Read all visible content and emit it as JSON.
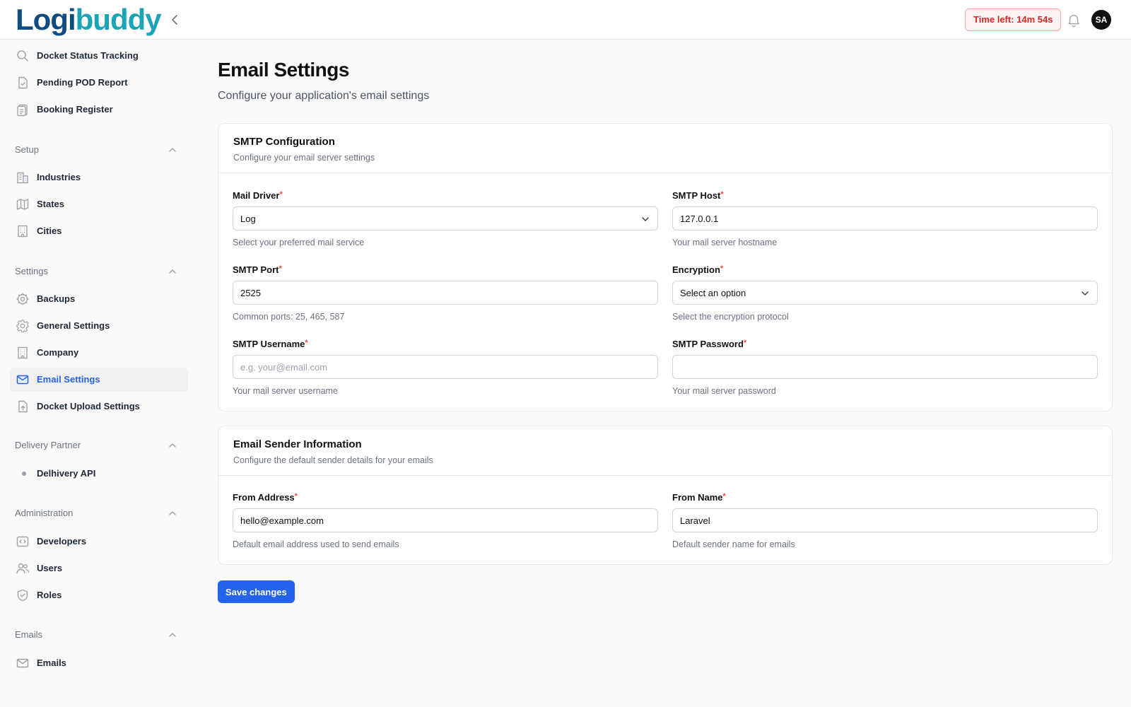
{
  "header": {
    "logo_text_a": "Logi",
    "logo_text_b": "bu",
    "logo_text_c": "ddy",
    "timer": "Time left: 14m 54s",
    "avatar_initials": "SA"
  },
  "sidebar": {
    "top_items": [
      {
        "label": "Docket Status Tracking",
        "icon": "search-icon"
      },
      {
        "label": "Pending POD Report",
        "icon": "file-check-icon"
      },
      {
        "label": "Booking Register",
        "icon": "clipboard-icon"
      }
    ],
    "sections": {
      "setup": {
        "label": "Setup",
        "items": [
          "Industries",
          "States",
          "Cities"
        ]
      },
      "settings": {
        "label": "Settings",
        "items": [
          "Backups",
          "General Settings",
          "Company",
          "Email Settings",
          "Docket Upload Settings"
        ]
      },
      "delivery_partner": {
        "label": "Delivery Partner",
        "items": [
          "Delhivery API"
        ]
      },
      "administration": {
        "label": "Administration",
        "items": [
          "Developers",
          "Users",
          "Roles"
        ]
      },
      "emails": {
        "label": "Emails",
        "items": [
          "Emails"
        ]
      }
    },
    "active_item": "Email Settings"
  },
  "page": {
    "title": "Email Settings",
    "subtitle": "Configure your application's email settings"
  },
  "smtp_card": {
    "title": "SMTP Configuration",
    "description": "Configure your email server settings",
    "fields": {
      "mail_driver": {
        "label": "Mail Driver",
        "value": "Log",
        "help": "Select your preferred mail service"
      },
      "smtp_host": {
        "label": "SMTP Host",
        "value": "127.0.0.1",
        "help": "Your mail server hostname"
      },
      "smtp_port": {
        "label": "SMTP Port",
        "value": "2525",
        "help": "Common ports: 25, 465, 587"
      },
      "encryption": {
        "label": "Encryption",
        "value": "Select an option",
        "help": "Select the encryption protocol"
      },
      "smtp_username": {
        "label": "SMTP Username",
        "value": "",
        "placeholder": "e.g. your@email.com",
        "help": "Your mail server username"
      },
      "smtp_password": {
        "label": "SMTP Password",
        "value": "",
        "help": "Your mail server password"
      }
    }
  },
  "sender_card": {
    "title": "Email Sender Information",
    "description": "Configure the default sender details for your emails",
    "fields": {
      "from_address": {
        "label": "From Address",
        "value": "hello@example.com",
        "help": "Default email address used to send emails"
      },
      "from_name": {
        "label": "From Name",
        "value": "Laravel",
        "help": "Default sender name for emails"
      }
    }
  },
  "actions": {
    "save_label": "Save changes"
  },
  "colors": {
    "accent": "#2563eb",
    "required": "#ef4444",
    "timer_text": "#dc2626"
  }
}
